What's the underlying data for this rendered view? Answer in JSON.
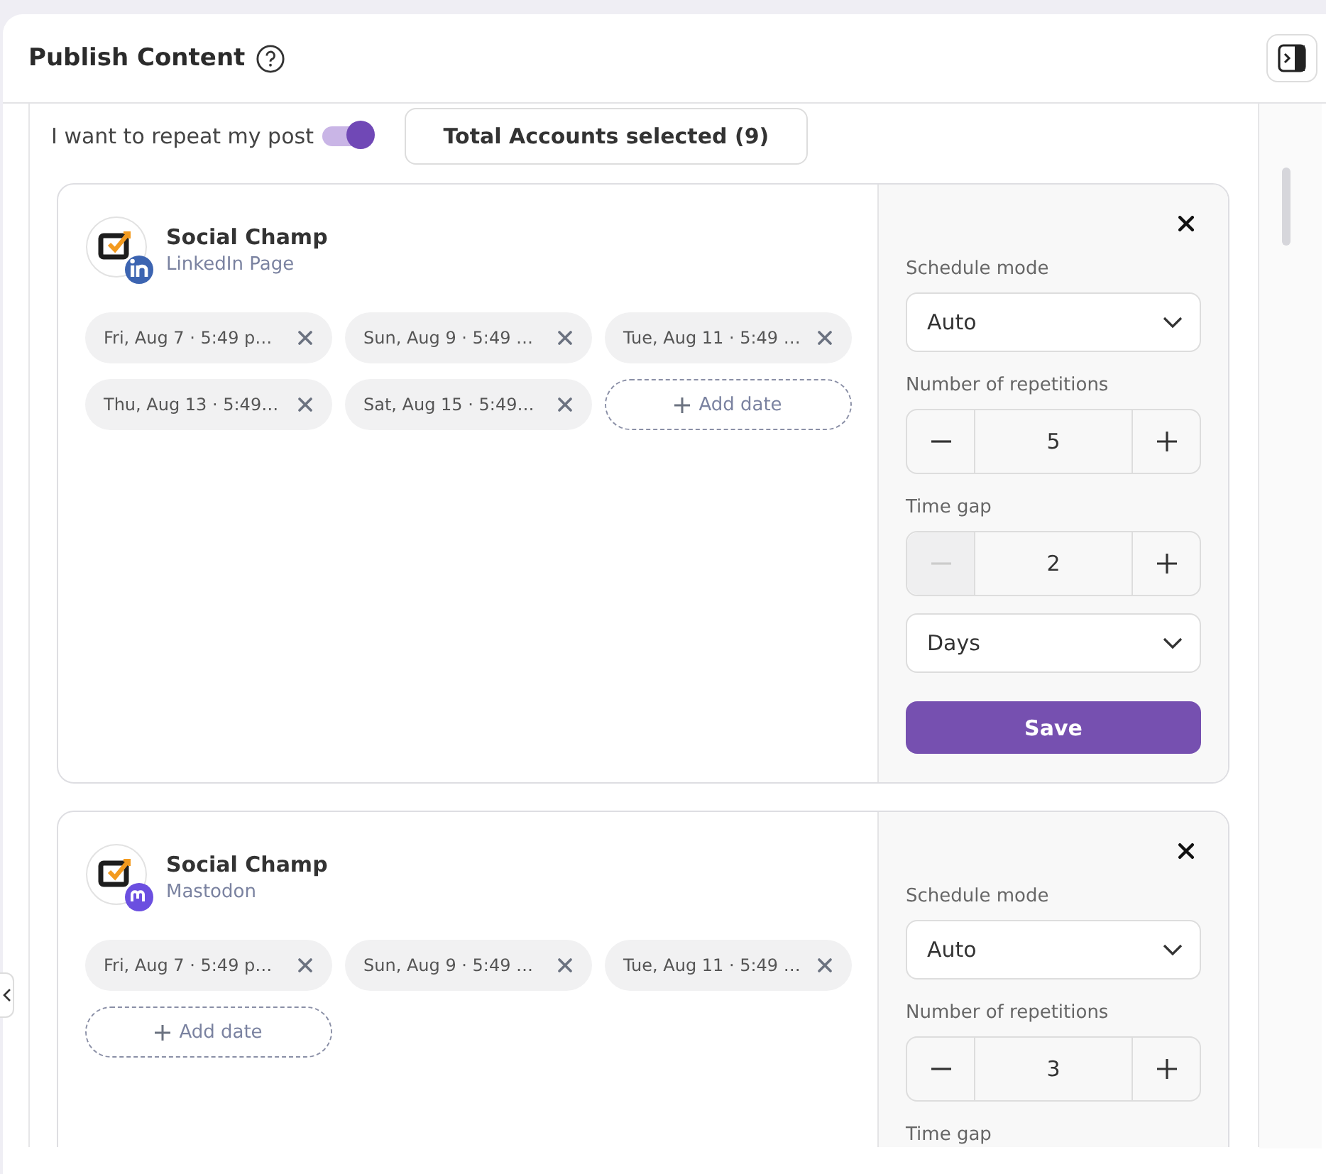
{
  "header": {
    "title": "Publish Content"
  },
  "repeat": {
    "label": "I want to repeat my post",
    "on": true
  },
  "total_accounts": "Total Accounts selected (9)",
  "accounts": [
    {
      "name": "Social Champ",
      "network": "LinkedIn Page",
      "kind": "linkedin",
      "dates": [
        "Fri, Aug 7 · 5:49 p…",
        "Sun, Aug 9 · 5:49 …",
        "Tue, Aug 11 · 5:49 …",
        "Thu, Aug 13 · 5:49…",
        "Sat, Aug 15 · 5:49…"
      ],
      "add_date": "Add date",
      "settings": {
        "schedule_label": "Schedule mode",
        "schedule_mode": "Auto",
        "steppers": [
          {
            "label": "Number of repetitions",
            "value": "5",
            "minus_disabled": false
          },
          {
            "label": "Time gap",
            "value": "2",
            "minus_disabled": true
          }
        ],
        "unit": "Days",
        "save": "Save"
      }
    },
    {
      "name": "Social Champ",
      "network": "Mastodon",
      "kind": "mastodon",
      "dates": [
        "Fri, Aug 7 · 5:49 p…",
        "Sun, Aug 9 · 5:49 …",
        "Tue, Aug 11 · 5:49 …"
      ],
      "add_date": "Add date",
      "settings": {
        "schedule_label": "Schedule mode",
        "schedule_mode": "Auto",
        "steppers": [
          {
            "label": "Number of repetitions",
            "value": "3",
            "minus_disabled": false
          }
        ],
        "next_label": "Time gap"
      }
    }
  ]
}
